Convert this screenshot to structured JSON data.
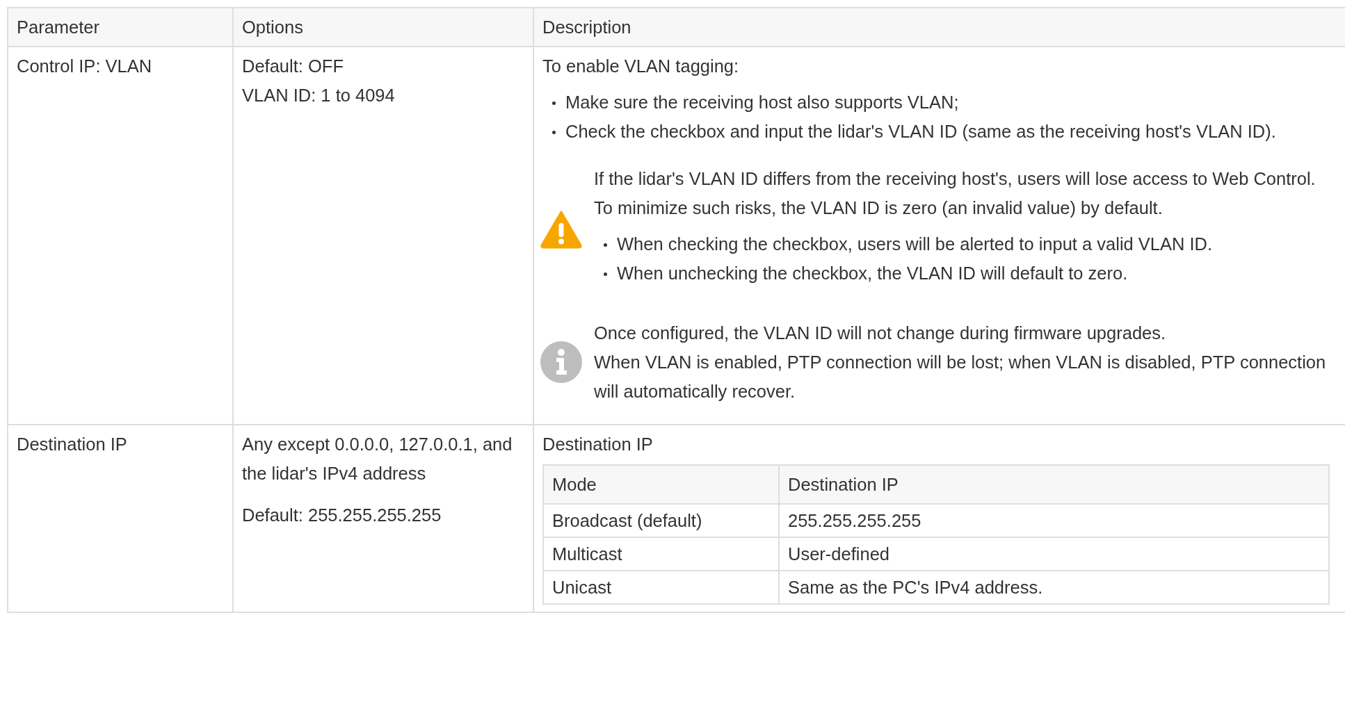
{
  "table": {
    "columns": [
      "Parameter",
      "Options",
      "Description"
    ],
    "rows": [
      {
        "parameter": "Control IP: VLAN",
        "options": [
          {
            "lines": [
              "Default: OFF",
              "VLAN ID: 1 to 4094"
            ]
          }
        ],
        "description": [
          {
            "kind": "paragraph",
            "text": "To enable VLAN tagging:"
          },
          {
            "kind": "bullets",
            "items": [
              "Make sure the receiving host also supports VLAN;",
              "Check the checkbox and input the lidar's VLAN ID (same as the receiving host's VLAN ID)."
            ]
          },
          {
            "kind": "warning_note",
            "blocks": [
              {
                "kind": "paragraph",
                "text": "If the lidar's VLAN ID differs from the receiving host's, users will lose access to Web Control. To minimize such risks, the VLAN ID is zero (an invalid value) by default."
              },
              {
                "kind": "bullets",
                "items": [
                  "When checking the checkbox, users will be alerted to input a valid VLAN ID.",
                  "When unchecking the checkbox, the VLAN ID will default to zero."
                ]
              }
            ]
          },
          {
            "kind": "info_note",
            "blocks": [
              {
                "kind": "lines",
                "lines": [
                  "Once configured, the VLAN ID will not change during firmware upgrades.",
                  "When VLAN is enabled, PTP connection will be lost; when VLAN is disabled, PTP connection will automatically recover."
                ]
              }
            ]
          }
        ]
      },
      {
        "parameter": "Destination IP",
        "options": [
          {
            "lines": [
              "Any except 0.0.0.0, 127.0.0.1, and the lidar's IPv4 address"
            ]
          },
          {
            "lines": [
              "Default: 255.255.255.255"
            ]
          }
        ],
        "description": [
          {
            "kind": "paragraph",
            "text": "Destination IP"
          },
          {
            "kind": "table",
            "columns": [
              "Mode",
              "Destination IP"
            ],
            "rows": [
              [
                "Broadcast (default)",
                "255.255.255.255"
              ],
              [
                "Multicast",
                "User-defined"
              ],
              [
                "Unicast",
                "Same as the PC's IPv4 address."
              ]
            ]
          }
        ]
      }
    ]
  }
}
